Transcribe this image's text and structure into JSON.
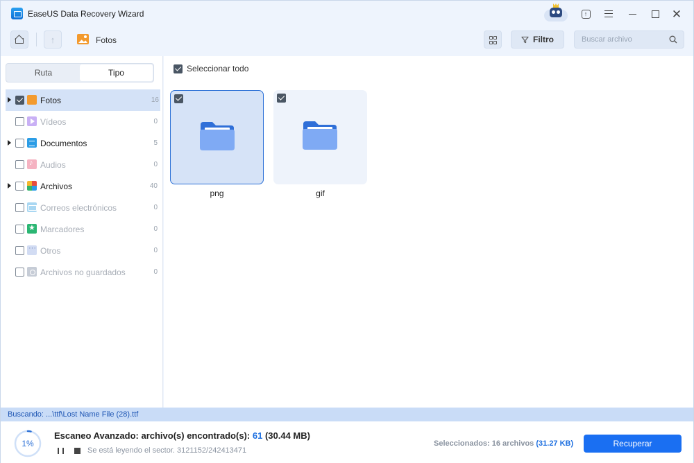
{
  "window": {
    "title": "EaseUS Data Recovery Wizard"
  },
  "titlebar": {
    "icons": [
      "mascot-icon",
      "upgrade-icon",
      "menu-icon",
      "minimize-icon",
      "maximize-icon",
      "close-icon"
    ],
    "upgrade_glyph": "↑",
    "close_glyph": "✕"
  },
  "toolbar": {
    "up_glyph": "↑",
    "breadcrumb": "Fotos",
    "filter_label": "Filtro",
    "search_placeholder": "Buscar archivo"
  },
  "sidebar": {
    "tabs": [
      {
        "label": "Ruta"
      },
      {
        "label": "Tipo",
        "active": true
      }
    ],
    "categories": [
      {
        "label": "Fotos",
        "count": "16",
        "checked": true,
        "expandable": true,
        "active": true,
        "icon": "photo-icon"
      },
      {
        "label": "Vídeos",
        "count": "0",
        "checked": false,
        "expandable": false,
        "active": false,
        "icon": "video-icon"
      },
      {
        "label": "Documentos",
        "count": "5",
        "checked": false,
        "expandable": true,
        "active": true,
        "icon": "document-icon"
      },
      {
        "label": "Audios",
        "count": "0",
        "checked": false,
        "expandable": false,
        "active": false,
        "icon": "audio-icon"
      },
      {
        "label": "Archivos",
        "count": "40",
        "checked": false,
        "expandable": true,
        "active": true,
        "icon": "archive-icon"
      },
      {
        "label": "Correos electrónicos",
        "count": "0",
        "checked": false,
        "expandable": false,
        "active": false,
        "icon": "mail-icon"
      },
      {
        "label": "Marcadores",
        "count": "0",
        "checked": false,
        "expandable": false,
        "active": false,
        "icon": "bookmark-icon"
      },
      {
        "label": "Otros",
        "count": "0",
        "checked": false,
        "expandable": false,
        "active": false,
        "icon": "other-icon"
      },
      {
        "label": "Archivos no guardados",
        "count": "0",
        "checked": false,
        "expandable": false,
        "active": false,
        "icon": "unsaved-icon"
      }
    ]
  },
  "main": {
    "select_all_label": "Seleccionar todo",
    "folders": [
      {
        "name": "png",
        "checked": true,
        "selected": true
      },
      {
        "name": "gif",
        "checked": true,
        "selected": false
      }
    ]
  },
  "status": {
    "searching": "Buscando: ...\\ttf\\Lost Name File (28).ttf",
    "progress_percent": 1,
    "progress_label": "1%",
    "scan_prefix": "Escaneo Avanzado: archivo(s) encontrado(s):",
    "found_count": "61",
    "found_size": "(30.44 MB)",
    "sector_text": "Se está leyendo el sector. 3121152/242413471",
    "selected_prefix": "Seleccionados: 16 archivos",
    "selected_size": "(31.27 KB)",
    "recover_label": "Recuperar"
  },
  "colors": {
    "accent": "#1a6ff2",
    "highlight": "#1d6fe0",
    "scan_strip": "#c9dcf7"
  }
}
